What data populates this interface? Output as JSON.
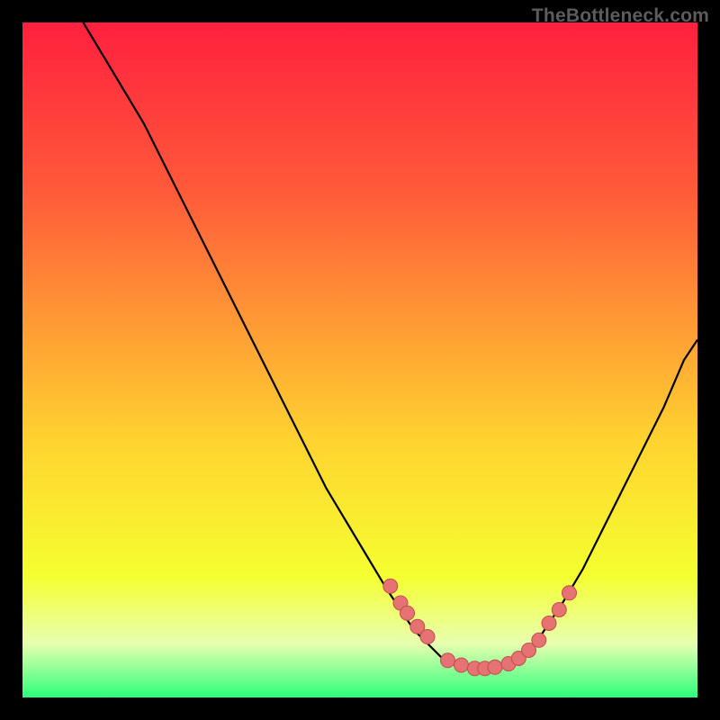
{
  "watermark": "TheBottleneck.com",
  "colors": {
    "background_black": "#000000",
    "grad_top": "#ff203f",
    "grad_upper_mid": "#ff5a3a",
    "grad_mid": "#ffd330",
    "grad_low": "#f4ff30",
    "grad_pale": "#e8ffb0",
    "grad_bottom": "#2cff7a",
    "curve": "#000000",
    "dot_fill": "#e57373",
    "dot_stroke": "#c54b4b",
    "watermark": "#5c5c5c"
  },
  "chart_data": {
    "type": "line",
    "title": "",
    "xlabel": "",
    "ylabel": "",
    "xlim": [
      0,
      100
    ],
    "ylim": [
      0,
      100
    ],
    "curve": {
      "name": "bottleneck-curve",
      "x": [
        9,
        12,
        15,
        18,
        21,
        24,
        27,
        30,
        33,
        36,
        39,
        42,
        45,
        48,
        51,
        54,
        56,
        58,
        60,
        62,
        64,
        66,
        68,
        70,
        72,
        74,
        76,
        78,
        80,
        83,
        86,
        89,
        92,
        95,
        98,
        100
      ],
      "y": [
        100,
        95,
        90,
        85,
        79,
        73,
        67,
        61,
        55,
        49,
        43,
        37,
        31,
        26,
        21,
        16,
        13,
        10,
        8,
        6,
        5,
        4.5,
        4.3,
        4.5,
        5,
        6,
        8,
        11,
        14,
        19,
        25,
        31,
        37,
        43,
        50,
        53
      ]
    },
    "dots": {
      "name": "salient-points",
      "x": [
        54.5,
        56,
        57,
        58.5,
        60,
        63,
        65,
        67,
        68.5,
        70,
        72,
        73.5,
        75,
        76.5,
        78,
        79.5,
        81
      ],
      "y": [
        16.5,
        14,
        12.5,
        10.5,
        9,
        5.5,
        4.8,
        4.3,
        4.3,
        4.5,
        5,
        5.8,
        7,
        8.5,
        11,
        13,
        15.5
      ]
    }
  }
}
